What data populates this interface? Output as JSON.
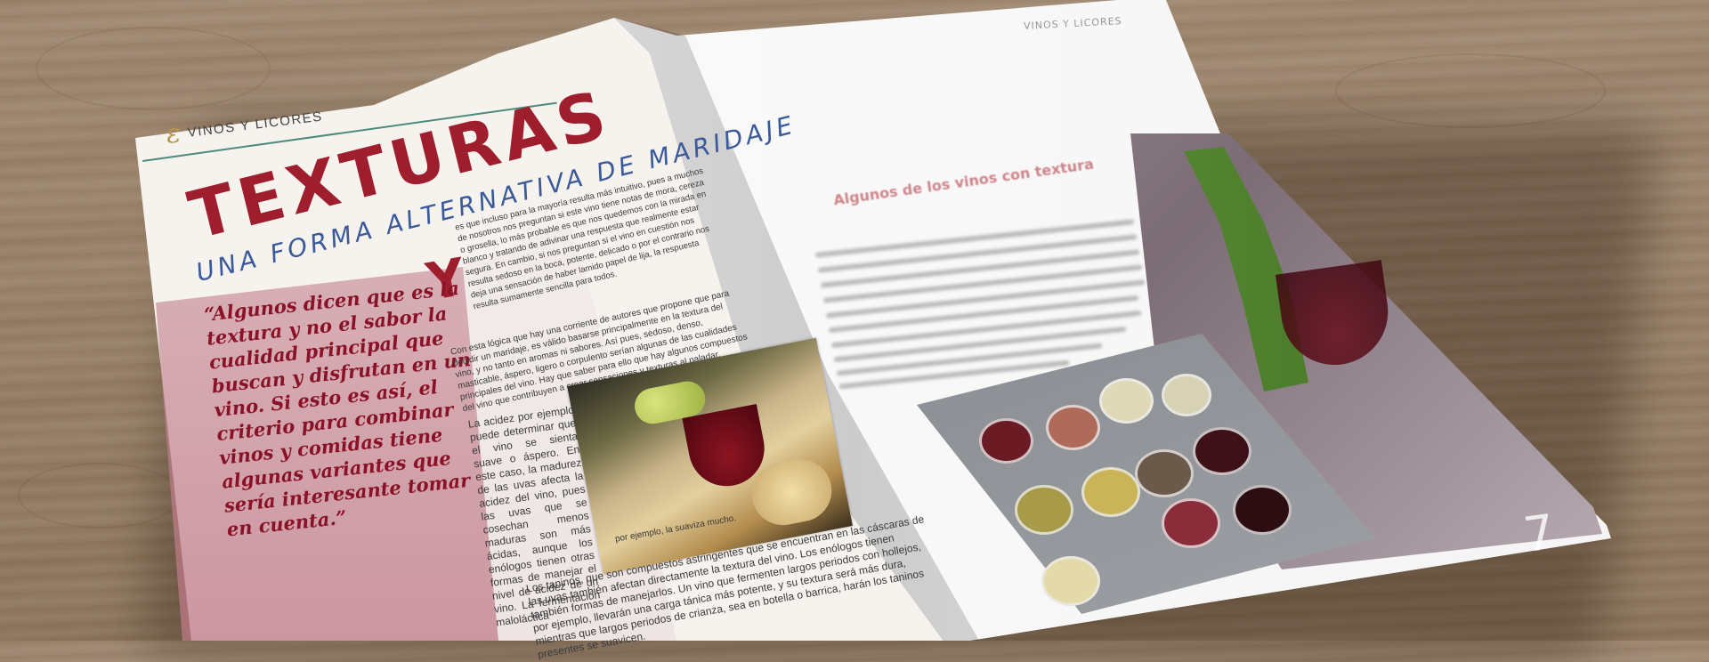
{
  "left_page": {
    "section_emblem": "ε",
    "section_label": "VINOS Y LICORES",
    "title": "TEXTURAS",
    "subtitle": "UNA FORMA ALTERNATIVA DE MARIDAJE",
    "drop_cap": "Y",
    "pull_quote": "“Algunos dicen que es la textura y no el sabor la cualidad principal que buscan y disfrutan en un vino. Si esto es así, el criterio para combinar vinos y comidas tiene algunas variantes que sería interesante tomar en cuenta.”",
    "column_top": "es que incluso para la mayoría resulta más intuitivo, pues a muchos de nosotros nos preguntan si este vino tiene notas de mora, cereza o grosella, lo más probable es que nos quedemos con la mirada en blanco y tratando de adivinar una respuesta que realmente estar segura. En cambio, si nos preguntan si el vino en cuestión nos resulta sedoso en la boca, potente, delicado o por el contrario nos deja una sensación de haber lamido papel de lija, la respuesta resulta sumamente sencilla para todos.",
    "column_mid": "Con esta lógica que hay una corriente de autores que propone que para decidir un maridaje, es válido basarse principalmente en la textura del vino, y no tanto en aromas ni sabores. Así pues, sedoso, denso, masticable, áspero, ligero o corpulento serían algunas de las cualidades principales del vino. Hay que saber para ello que hay algunos compuestos del vino que contribuyen a crear sensaciones y texturas al paladar.",
    "column_left": "La acidez por ejemplo puede determinar que el vino se sienta suave o áspero. En este caso, la madurez de las uvas afecta la acidez del vino, pues las uvas que se cosechan menos maduras son más ácidas, aunque los enólogos tienen otras formas de manejar el nivel de acidez de un vino. La fermentación maloláctica",
    "caption": "por ejemplo, la suaviza mucho.",
    "column_bottom": "Los taninos, que son compuestos astringentes que se encuentran en las cáscaras de las uvas también afectan directamente la textura del vino. Los enólogos tienen también formas de manejarlos. Un vino que fermenten largos periodos con hollejos, por ejemplo, llevarán una carga tánica más potente, y su textura será más dura, mientras que largos periodos de crianza, sea en botella o barrica, harán los taninos presentes se suavicen."
  },
  "right_page": {
    "header": "VINOS Y LICORES",
    "heading": "Algunos de los vinos con textura",
    "subheading": "",
    "page_number": "7"
  }
}
